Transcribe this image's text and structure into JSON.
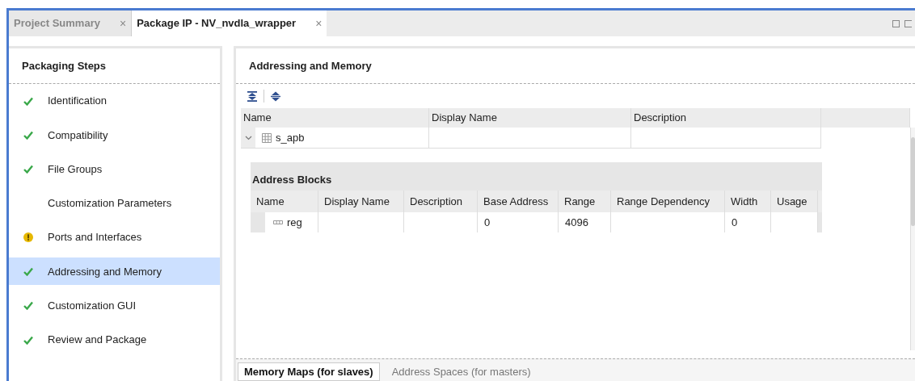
{
  "editor_tabs": [
    {
      "label": "Project Summary",
      "close": "×",
      "selected": false
    },
    {
      "label": "Package IP - NV_nvdla_wrapper",
      "close": "×",
      "selected": true
    }
  ],
  "steps_panel": {
    "title": "Packaging Steps",
    "items": [
      {
        "label": "Identification",
        "kind": "done",
        "selected": false
      },
      {
        "label": "Compatibility",
        "kind": "done",
        "selected": false
      },
      {
        "label": "File Groups",
        "kind": "done",
        "selected": false
      },
      {
        "label": "Customization Parameters",
        "kind": "plain",
        "selected": false
      },
      {
        "label": "Ports and Interfaces",
        "kind": "warning",
        "selected": false
      },
      {
        "label": "Addressing and Memory",
        "kind": "done",
        "selected": true
      },
      {
        "label": "Customization GUI",
        "kind": "done",
        "selected": false
      },
      {
        "label": "Review and Package",
        "kind": "done",
        "selected": false
      }
    ]
  },
  "main_panel": {
    "title": "Addressing and Memory",
    "table": {
      "columns": [
        "Name",
        "Display Name",
        "Description"
      ],
      "rows": [
        {
          "name": "s_apb",
          "display_name": "",
          "description": "",
          "expanded": true,
          "address_blocks": {
            "title": "Address Blocks",
            "columns": [
              "Name",
              "Display Name",
              "Description",
              "Base Address",
              "Range",
              "Range Dependency",
              "Width",
              "Usage"
            ],
            "rows": [
              [
                "reg",
                "",
                "",
                "0",
                "4096",
                "",
                "0",
                ""
              ]
            ]
          }
        }
      ]
    },
    "bottom_tabs": [
      {
        "label": "Memory Maps (for slaves)",
        "selected": true
      },
      {
        "label": "Address Spaces (for masters)",
        "selected": false
      }
    ]
  }
}
